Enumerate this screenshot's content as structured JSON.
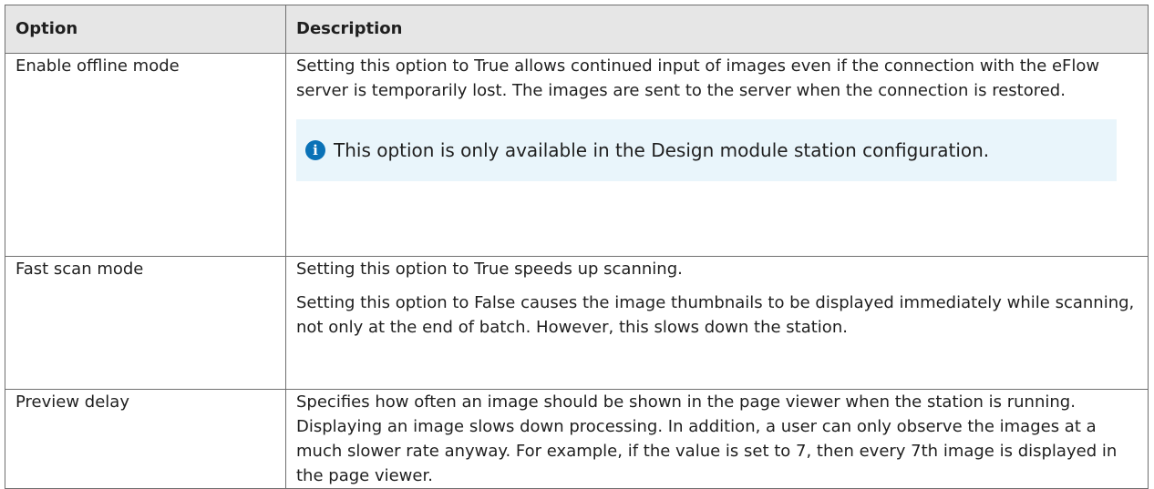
{
  "table": {
    "headers": {
      "option": "Option",
      "description": "Description"
    },
    "rows": [
      {
        "option": "Enable offline mode",
        "paragraphs": [
          "Setting this option to True allows continued input of images even if the connection with the eFlow server is temporarily lost. The images are sent to the server when the connection is restored."
        ],
        "note": {
          "icon": "info-icon",
          "text": "This option is only available in the Design module station configuration."
        }
      },
      {
        "option": "Fast scan mode",
        "paragraphs": [
          "Setting this option to True speeds up scanning.",
          "Setting this option to False causes the image thumbnails to be displayed immediately while scanning, not only at the end of batch. However, this slows down the station."
        ]
      },
      {
        "option": "Preview delay",
        "paragraphs": [
          "Specifies how often an image should be shown in the page viewer when the station is running. Displaying an image slows down processing. In addition, a user can only observe the images at a much slower rate anyway. For example, if the value is set to 7, then every 7th image is displayed in the page viewer."
        ]
      }
    ]
  },
  "colors": {
    "header_background": "#e6e6e6",
    "note_background": "#e9f5fb",
    "info_icon": "#0a72b7",
    "border": "#6f6f6f"
  }
}
